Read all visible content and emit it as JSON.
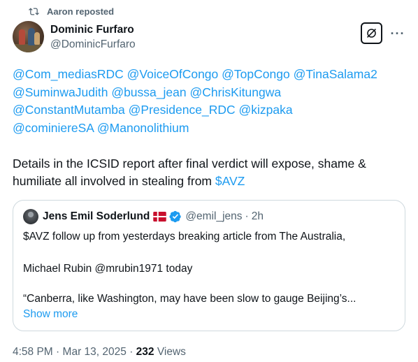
{
  "repost": {
    "label": "Aaron reposted",
    "icon": "repost-icon"
  },
  "author": {
    "display_name": "Dominic Furfaro",
    "handle": "@DominicFurfaro"
  },
  "actions": {
    "grok_icon": "grok-icon",
    "more_icon": "more-icon",
    "more_label": "···"
  },
  "mentions": [
    "@Com_mediasRDC",
    "@VoiceOfCongo",
    "@TopCongo",
    "@TinaSalama2",
    "@SuminwaJudith",
    "@bussa_jean",
    "@ChrisKitungwa",
    "@ConstantMutamba",
    "@Presidence_RDC",
    "@kizpaka",
    "@cominiereSA",
    "@Manonolithium"
  ],
  "body": {
    "text": "Details in the ICSID report after final verdict will expose, shame & humiliate all involved in stealing from ",
    "cashtag": "$AVZ"
  },
  "quote": {
    "name": "Jens Emil Soderlund",
    "flag_icon": "denmark-flag-icon",
    "verified_icon": "verified-badge-icon",
    "handle": "@emil_jens",
    "separator": "·",
    "time": "2h",
    "line1": "$AVZ follow up from yesterdays breaking article from The Australia,",
    "line2": "Michael Rubin @mrubin1971 today",
    "line3": "“Canberra, like Washington, may have been slow to gauge Beijing’s...",
    "show_more": "Show more"
  },
  "meta": {
    "time": "4:58 PM",
    "sep1": "·",
    "date": "Mar 13, 2025",
    "sep2": "·",
    "views_count": "232",
    "views_label": "Views"
  },
  "colors": {
    "link": "#1d9bf0",
    "secondary": "#536471",
    "primary_text": "#0f1419",
    "border": "#cfd9de",
    "verified": "#1d9bf0",
    "flag_red": "#c8102e"
  }
}
